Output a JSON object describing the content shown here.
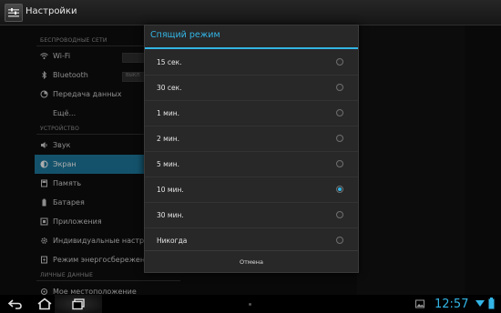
{
  "app": {
    "title": "Настройки"
  },
  "settings": {
    "cat_wireless": "БЕСПРОВОДНЫЕ СЕТИ",
    "cat_device": "УСТРОЙСТВО",
    "cat_personal": "ЛИЧНЫЕ ДАННЫЕ",
    "wifi": "Wi-Fi",
    "bluetooth": "Bluetooth",
    "bt_chip": "ВЫКЛ",
    "data": "Передача данных",
    "more": "Ещё...",
    "sound": "Звук",
    "screen": "Экран",
    "memory": "Память",
    "battery": "Батарея",
    "apps": "Приложения",
    "custom": "Индивидуальные настройки",
    "power": "Режим энергосбережения",
    "location": "Мое местоположение"
  },
  "dialog": {
    "title": "Спящий режим",
    "options": [
      "15 сек.",
      "30 сек.",
      "1 мин.",
      "2 мин.",
      "5 мин.",
      "10 мин.",
      "30 мин.",
      "Никогда"
    ],
    "selected": "10 мин.",
    "cancel": "Отмена"
  },
  "system": {
    "clock": "12:57"
  },
  "colors": {
    "accent": "#33b5e5",
    "selected_row": "#1b6e8f"
  }
}
